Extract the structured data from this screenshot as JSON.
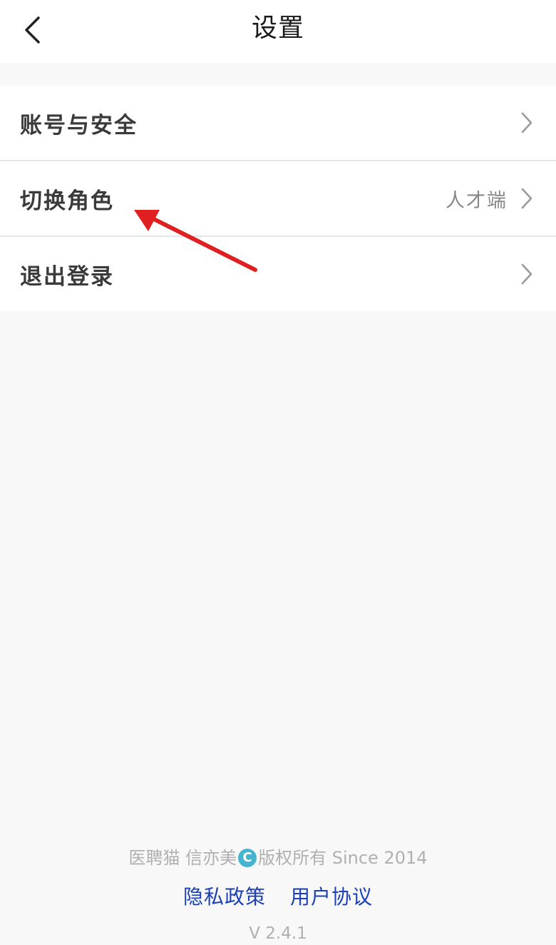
{
  "header": {
    "title": "设置",
    "back_icon": "chevron-left-icon"
  },
  "menu": {
    "items": [
      {
        "label": "账号与安全",
        "value": ""
      },
      {
        "label": "切换角色",
        "value": "人才端"
      },
      {
        "label": "退出登录",
        "value": ""
      }
    ],
    "chevron_icon": "chevron-right-icon"
  },
  "annotation": {
    "arrow_color": "#e02020"
  },
  "footer": {
    "copyright_prefix": "医聘猫 信亦美",
    "copyright_mark": "C",
    "copyright_suffix": "版权所有 Since 2014",
    "privacy_link": "隐私政策",
    "agreement_link": "用户协议",
    "version": "V 2.4.1"
  },
  "colors": {
    "background": "#f8f8f8",
    "link": "#1a3fb8",
    "muted": "#b0b0b0",
    "copyright_mark": "#45b4cf"
  }
}
